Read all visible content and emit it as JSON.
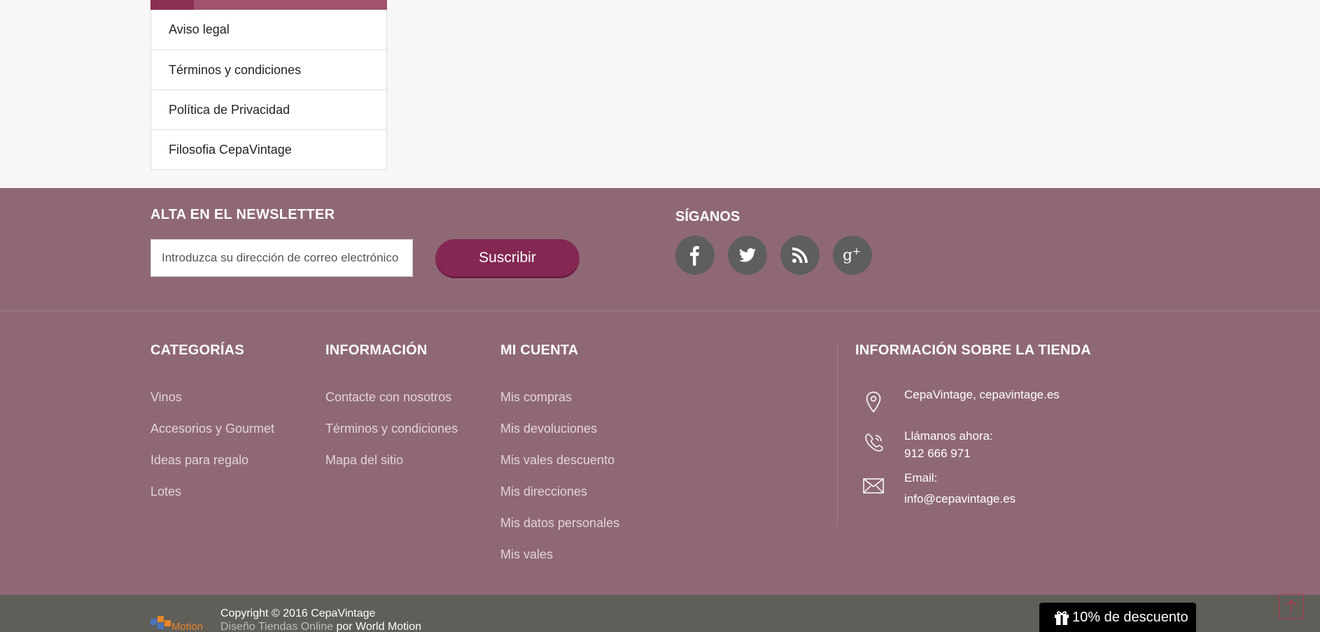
{
  "cms_links": {
    "items": [
      {
        "label": "Aviso legal"
      },
      {
        "label": "Términos y condiciones"
      },
      {
        "label": "Política de Privacidad"
      },
      {
        "label": "Filosofia CepaVintage"
      }
    ]
  },
  "newsletter": {
    "title": "ALTA EN EL NEWSLETTER",
    "placeholder": "Introduzca su dirección de correo electrónico",
    "button_label": "Suscribir"
  },
  "follow": {
    "title": "SÍGANOS",
    "networks": [
      {
        "name": "facebook",
        "icon": "facebook-icon"
      },
      {
        "name": "twitter",
        "icon": "twitter-icon"
      },
      {
        "name": "rss",
        "icon": "rss-icon"
      },
      {
        "name": "google-plus",
        "icon": "google-plus-icon"
      }
    ]
  },
  "columns": {
    "categorias": {
      "title": "CATEGORÍAS",
      "links": [
        "Vinos",
        "Accesorios y Gourmet",
        "Ideas para regalo",
        "Lotes"
      ]
    },
    "informacion": {
      "title": "INFORMACIÓN",
      "links": [
        "Contacte con nosotros",
        "Términos y condiciones",
        "Mapa del sitio"
      ]
    },
    "mi_cuenta": {
      "title": "MI CUENTA",
      "links": [
        "Mis compras",
        "Mis devoluciones",
        "Mis vales descuento",
        "Mis direcciones",
        "Mis datos personales",
        "Mis vales"
      ]
    },
    "tienda": {
      "title": "INFORMACIÓN SOBRE LA TIENDA",
      "address": "CepaVintage, cepavintage.es",
      "phone_label": "Llámanos ahora:",
      "phone": "912 666 971",
      "email_label": "Email:",
      "email": "info@cepavintage.es"
    }
  },
  "bottom": {
    "logo_text": "Motion",
    "copyright": "Copyright © 2016 CepaVintage",
    "credits_prefix": "Diseño Tiendas Online",
    "credits_suffix": "por World Motion"
  },
  "discount_tab": {
    "label": "10% de descuento"
  },
  "colors": {
    "footer_bg": "#8f6876",
    "button_bg": "#842853",
    "bottom_bar": "#5f5e59",
    "accent_bar": "#a0526f"
  }
}
